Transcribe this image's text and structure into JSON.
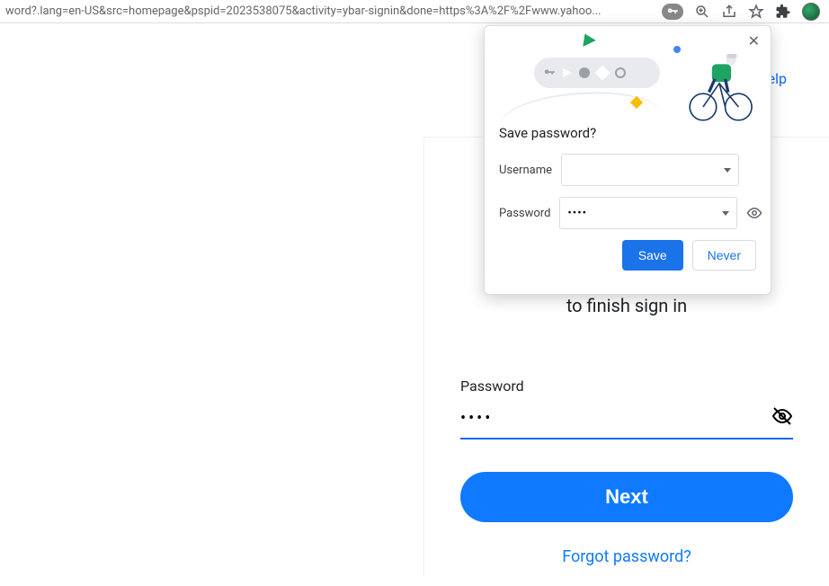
{
  "address_bar": {
    "url": "word?.lang=en-US&src=homepage&pspid=2023538075&activity=ybar-signin&done=https%3A%2F%2Fwww.yahoo..."
  },
  "help_link_label": "elp",
  "signin": {
    "finish_text": "to finish sign in",
    "password_label": "Password",
    "password_value": "••••",
    "next_label": "Next",
    "forgot_label": "Forgot password?"
  },
  "popup": {
    "title": "Save password?",
    "username_label": "Username",
    "username_value": "",
    "password_label": "Password",
    "password_value": "••••",
    "save_label": "Save",
    "never_label": "Never"
  }
}
